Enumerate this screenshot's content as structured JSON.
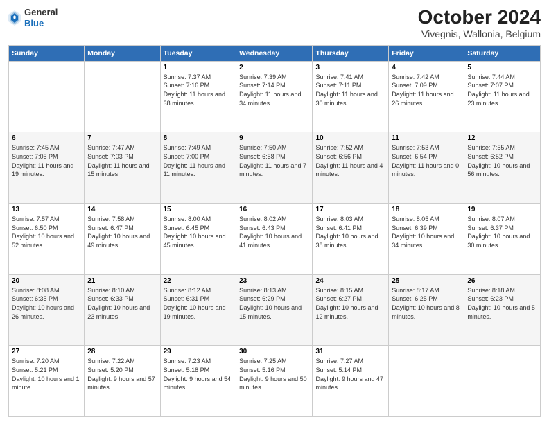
{
  "header": {
    "logo_general": "General",
    "logo_blue": "Blue",
    "title": "October 2024",
    "subtitle": "Vivegnis, Wallonia, Belgium"
  },
  "weekdays": [
    "Sunday",
    "Monday",
    "Tuesday",
    "Wednesday",
    "Thursday",
    "Friday",
    "Saturday"
  ],
  "weeks": [
    [
      {
        "num": "",
        "info": ""
      },
      {
        "num": "",
        "info": ""
      },
      {
        "num": "1",
        "info": "Sunrise: 7:37 AM\nSunset: 7:16 PM\nDaylight: 11 hours and 38 minutes."
      },
      {
        "num": "2",
        "info": "Sunrise: 7:39 AM\nSunset: 7:14 PM\nDaylight: 11 hours and 34 minutes."
      },
      {
        "num": "3",
        "info": "Sunrise: 7:41 AM\nSunset: 7:11 PM\nDaylight: 11 hours and 30 minutes."
      },
      {
        "num": "4",
        "info": "Sunrise: 7:42 AM\nSunset: 7:09 PM\nDaylight: 11 hours and 26 minutes."
      },
      {
        "num": "5",
        "info": "Sunrise: 7:44 AM\nSunset: 7:07 PM\nDaylight: 11 hours and 23 minutes."
      }
    ],
    [
      {
        "num": "6",
        "info": "Sunrise: 7:45 AM\nSunset: 7:05 PM\nDaylight: 11 hours and 19 minutes."
      },
      {
        "num": "7",
        "info": "Sunrise: 7:47 AM\nSunset: 7:03 PM\nDaylight: 11 hours and 15 minutes."
      },
      {
        "num": "8",
        "info": "Sunrise: 7:49 AM\nSunset: 7:00 PM\nDaylight: 11 hours and 11 minutes."
      },
      {
        "num": "9",
        "info": "Sunrise: 7:50 AM\nSunset: 6:58 PM\nDaylight: 11 hours and 7 minutes."
      },
      {
        "num": "10",
        "info": "Sunrise: 7:52 AM\nSunset: 6:56 PM\nDaylight: 11 hours and 4 minutes."
      },
      {
        "num": "11",
        "info": "Sunrise: 7:53 AM\nSunset: 6:54 PM\nDaylight: 11 hours and 0 minutes."
      },
      {
        "num": "12",
        "info": "Sunrise: 7:55 AM\nSunset: 6:52 PM\nDaylight: 10 hours and 56 minutes."
      }
    ],
    [
      {
        "num": "13",
        "info": "Sunrise: 7:57 AM\nSunset: 6:50 PM\nDaylight: 10 hours and 52 minutes."
      },
      {
        "num": "14",
        "info": "Sunrise: 7:58 AM\nSunset: 6:47 PM\nDaylight: 10 hours and 49 minutes."
      },
      {
        "num": "15",
        "info": "Sunrise: 8:00 AM\nSunset: 6:45 PM\nDaylight: 10 hours and 45 minutes."
      },
      {
        "num": "16",
        "info": "Sunrise: 8:02 AM\nSunset: 6:43 PM\nDaylight: 10 hours and 41 minutes."
      },
      {
        "num": "17",
        "info": "Sunrise: 8:03 AM\nSunset: 6:41 PM\nDaylight: 10 hours and 38 minutes."
      },
      {
        "num": "18",
        "info": "Sunrise: 8:05 AM\nSunset: 6:39 PM\nDaylight: 10 hours and 34 minutes."
      },
      {
        "num": "19",
        "info": "Sunrise: 8:07 AM\nSunset: 6:37 PM\nDaylight: 10 hours and 30 minutes."
      }
    ],
    [
      {
        "num": "20",
        "info": "Sunrise: 8:08 AM\nSunset: 6:35 PM\nDaylight: 10 hours and 26 minutes."
      },
      {
        "num": "21",
        "info": "Sunrise: 8:10 AM\nSunset: 6:33 PM\nDaylight: 10 hours and 23 minutes."
      },
      {
        "num": "22",
        "info": "Sunrise: 8:12 AM\nSunset: 6:31 PM\nDaylight: 10 hours and 19 minutes."
      },
      {
        "num": "23",
        "info": "Sunrise: 8:13 AM\nSunset: 6:29 PM\nDaylight: 10 hours and 15 minutes."
      },
      {
        "num": "24",
        "info": "Sunrise: 8:15 AM\nSunset: 6:27 PM\nDaylight: 10 hours and 12 minutes."
      },
      {
        "num": "25",
        "info": "Sunrise: 8:17 AM\nSunset: 6:25 PM\nDaylight: 10 hours and 8 minutes."
      },
      {
        "num": "26",
        "info": "Sunrise: 8:18 AM\nSunset: 6:23 PM\nDaylight: 10 hours and 5 minutes."
      }
    ],
    [
      {
        "num": "27",
        "info": "Sunrise: 7:20 AM\nSunset: 5:21 PM\nDaylight: 10 hours and 1 minute."
      },
      {
        "num": "28",
        "info": "Sunrise: 7:22 AM\nSunset: 5:20 PM\nDaylight: 9 hours and 57 minutes."
      },
      {
        "num": "29",
        "info": "Sunrise: 7:23 AM\nSunset: 5:18 PM\nDaylight: 9 hours and 54 minutes."
      },
      {
        "num": "30",
        "info": "Sunrise: 7:25 AM\nSunset: 5:16 PM\nDaylight: 9 hours and 50 minutes."
      },
      {
        "num": "31",
        "info": "Sunrise: 7:27 AM\nSunset: 5:14 PM\nDaylight: 9 hours and 47 minutes."
      },
      {
        "num": "",
        "info": ""
      },
      {
        "num": "",
        "info": ""
      }
    ]
  ]
}
